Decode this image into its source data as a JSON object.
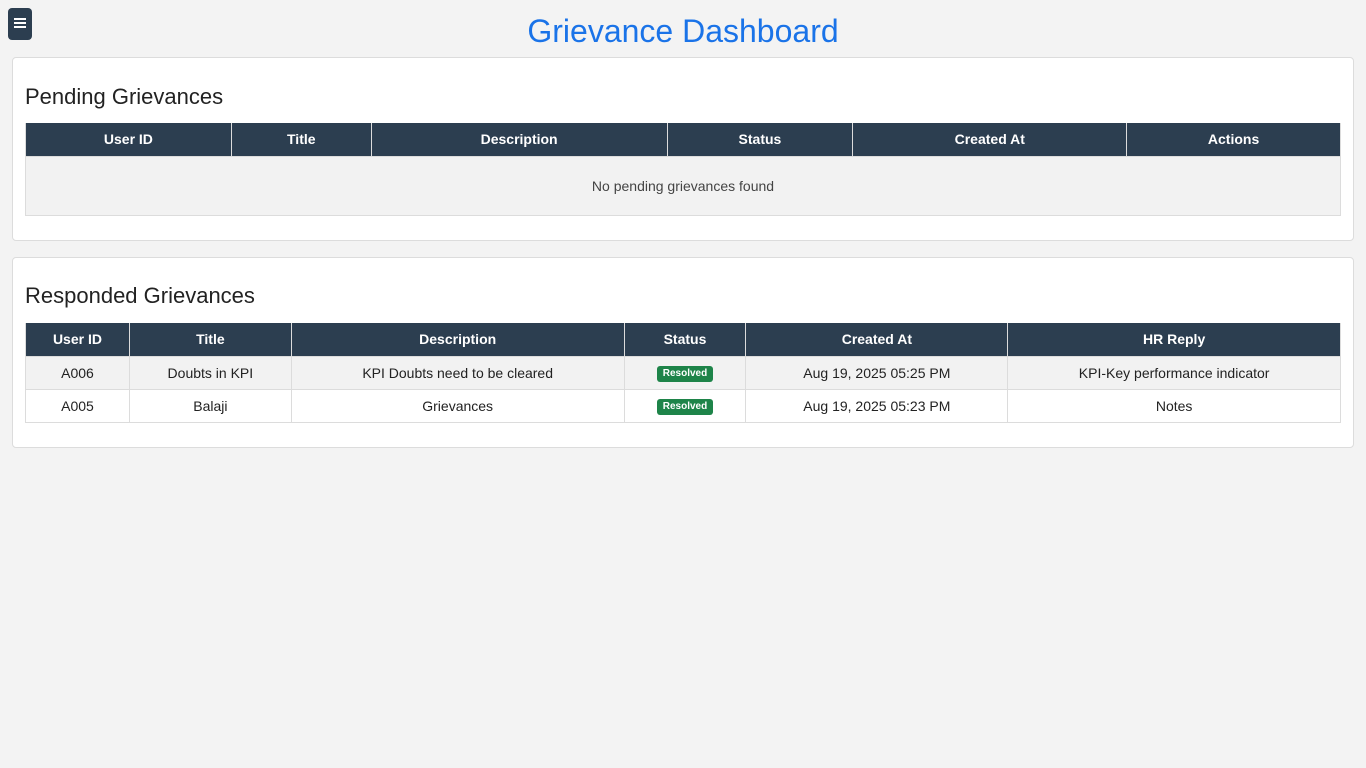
{
  "header": {
    "title": "Grievance Dashboard",
    "menu_icon": "hamburger-menu-icon"
  },
  "pending": {
    "heading": "Pending Grievances",
    "columns": [
      "User ID",
      "Title",
      "Description",
      "Status",
      "Created At",
      "Actions"
    ],
    "empty_message": "No pending grievances found"
  },
  "responded": {
    "heading": "Responded Grievances",
    "columns": [
      "User ID",
      "Title",
      "Description",
      "Status",
      "Created At",
      "HR Reply"
    ],
    "rows": [
      {
        "user_id": "A006",
        "title": "Doubts in KPI",
        "description": "KPI Doubts need to be cleared",
        "status": "Resolved",
        "created_at": "Aug 19, 2025 05:25 PM",
        "hr_reply": "KPI-Key performance indicator"
      },
      {
        "user_id": "A005",
        "title": "Balaji",
        "description": "Grievances",
        "status": "Resolved",
        "created_at": "Aug 19, 2025 05:23 PM",
        "hr_reply": "Notes"
      }
    ]
  },
  "colors": {
    "accent": "#1a73e8",
    "table_header": "#2c3e50",
    "status_resolved": "#1e8449"
  }
}
